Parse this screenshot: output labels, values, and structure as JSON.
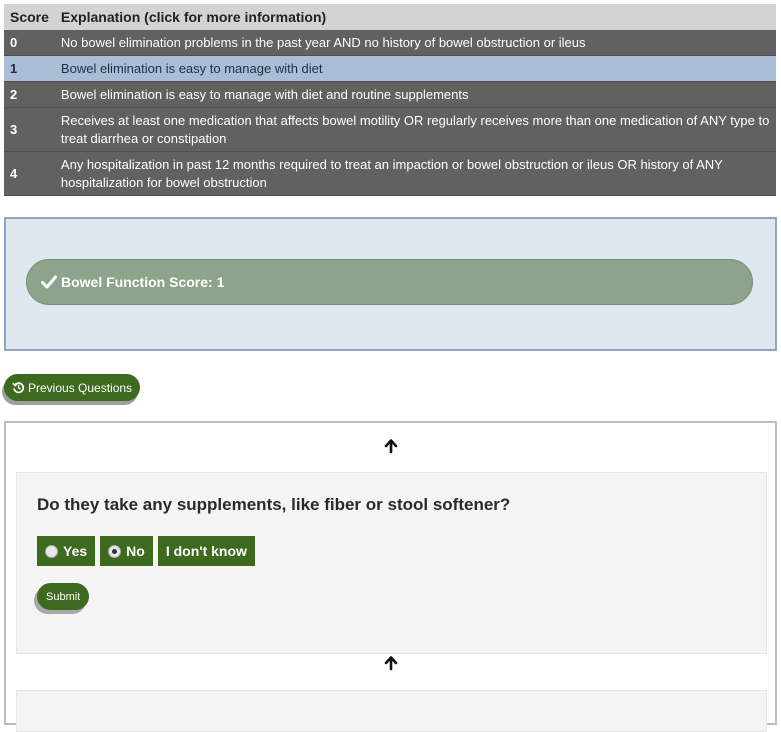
{
  "score_table": {
    "header_score": "Score",
    "header_explanation": "Explanation (click for more information)",
    "rows": [
      {
        "score": "0",
        "text": "No bowel elimination problems in the past year AND no history of bowel obstruction or ileus"
      },
      {
        "score": "1",
        "text": "Bowel elimination is easy to manage with diet"
      },
      {
        "score": "2",
        "text": "Bowel elimination is easy to manage with diet and routine supplements"
      },
      {
        "score": "3",
        "text": "Receives at least one medication that affects bowel motility OR regularly receives more than one medication of ANY type to treat diarrhea or constipation"
      },
      {
        "score": "4",
        "text": "Any hospitalization in past 12 months required to treat an impaction or bowel obstruction or ileus OR history of ANY hospitalization for bowel obstruction"
      }
    ],
    "selected_score": "1"
  },
  "result": {
    "label": "Bowel Function Score: 1",
    "icon": "check-icon"
  },
  "previous_questions": {
    "label": "Previous Questions",
    "icon": "history-icon"
  },
  "question": {
    "text": "Do they take any supplements, like fiber or stool softener?",
    "options": [
      {
        "label": "Yes",
        "has_radio": true,
        "checked": false
      },
      {
        "label": "No",
        "has_radio": true,
        "checked": true
      },
      {
        "label": "I don't know",
        "has_radio": false,
        "checked": false
      }
    ],
    "submit_label": "Submit"
  },
  "colors": {
    "table_header": "#d3d3d3",
    "table_row": "#616161",
    "selected_row": "#a9bed6",
    "result_bg": "#dfe7ef",
    "result_pill": "#8da38c",
    "button_green": "#3d6a1e"
  }
}
